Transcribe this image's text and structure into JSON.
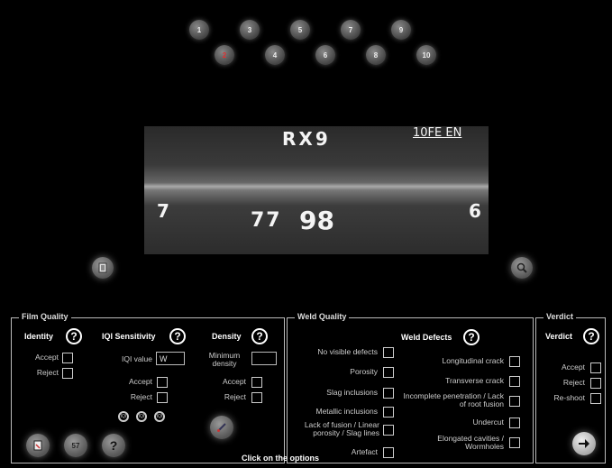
{
  "tabs": [
    "1",
    "2",
    "3",
    "4",
    "5",
    "6",
    "7",
    "8",
    "9",
    "10"
  ],
  "active_tab": "2",
  "film": {
    "top_code": "RX9",
    "top_right": "10FE EN",
    "left_mark": "7",
    "center_number_small": "77",
    "center_number_big": "98",
    "right_mark": "6"
  },
  "film_quality": {
    "title": "Film Quality",
    "identity": {
      "label": "Identity",
      "accept": "Accept",
      "reject": "Reject"
    },
    "iqi": {
      "label": "IQI Sensitivity",
      "value_label": "IQI value",
      "value": "W",
      "accept": "Accept",
      "reject": "Reject",
      "icons": [
        "IQI",
        "IQI",
        "IQI"
      ]
    },
    "density": {
      "label": "Density",
      "min_label": "Minimum density",
      "value": "",
      "accept": "Accept",
      "reject": "Reject"
    }
  },
  "weld_quality": {
    "title": "Weld Quality",
    "defects_label": "Weld Defects",
    "left_items": [
      "No visible defects",
      "Porosity",
      "Slag inclusions",
      "Metallic inclusions",
      "Lack of fusion / Linear porosity / Slag lines",
      "Artefact"
    ],
    "right_items": [
      "Longitudinal crack",
      "Transverse crack",
      "Incomplete penetration / Lack of root fusion",
      "Undercut",
      "Elongated cavities / Wormholes"
    ]
  },
  "verdict": {
    "title": "Verdict",
    "label": "Verdict",
    "options": [
      "Accept",
      "Reject",
      "Re-shoot"
    ]
  },
  "footer": {
    "counter": "57",
    "help": "?",
    "hint": "Click on the options"
  },
  "icons": {
    "notes": "notebook-icon",
    "zoom": "magnifier-icon",
    "report": "report-icon",
    "densitometer": "densitometer-icon",
    "next": "arrow-right-icon",
    "help": "question-icon"
  }
}
